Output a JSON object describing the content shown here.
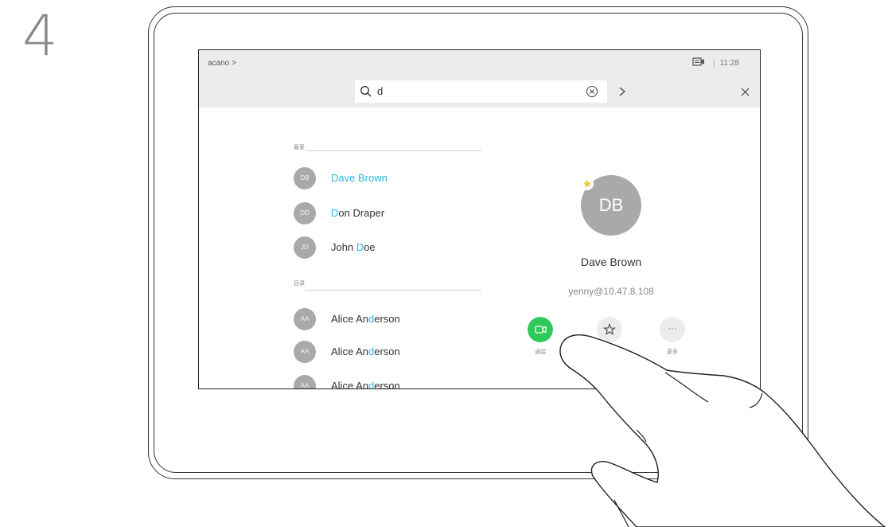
{
  "step_number": "4",
  "screen": {
    "breadcrumb": "acano >",
    "time": "11:28",
    "time_separator": "|",
    "search": {
      "value": "d"
    },
    "sections": {
      "favorites_label": "最爱",
      "directory_label": "目录"
    },
    "favorites": [
      {
        "initials": "DB",
        "name_pre": "",
        "name_hl": "D",
        "name_post": "ave Brown",
        "highlight_all": true
      },
      {
        "initials": "DD",
        "name_pre": "",
        "name_hl": "D",
        "name_post": "on Draper"
      },
      {
        "initials": "JD",
        "name_pre": "John ",
        "name_hl": "D",
        "name_post": "oe"
      }
    ],
    "directory": [
      {
        "initials": "AA",
        "name_pre": "Alice An",
        "name_hl": "d",
        "name_post": "erson"
      },
      {
        "initials": "AA",
        "name_pre": "Alice An",
        "name_hl": "d",
        "name_post": "erson"
      },
      {
        "initials": "AA",
        "name_pre": "Alice An",
        "name_hl": "d",
        "name_post": "erson"
      }
    ],
    "detail": {
      "initials": "DB",
      "name": "Dave Brown",
      "address": "yenny@10.47.8.108",
      "actions": {
        "call_label": "通話",
        "more_label": "更多",
        "more_glyph": "···"
      }
    },
    "colors": {
      "accent": "#2db7e8",
      "call_green": "#2fc85a",
      "topbar": "#ececec",
      "avatar_gray": "#a9a9a9",
      "favorite_star": "#f2c43c"
    }
  }
}
